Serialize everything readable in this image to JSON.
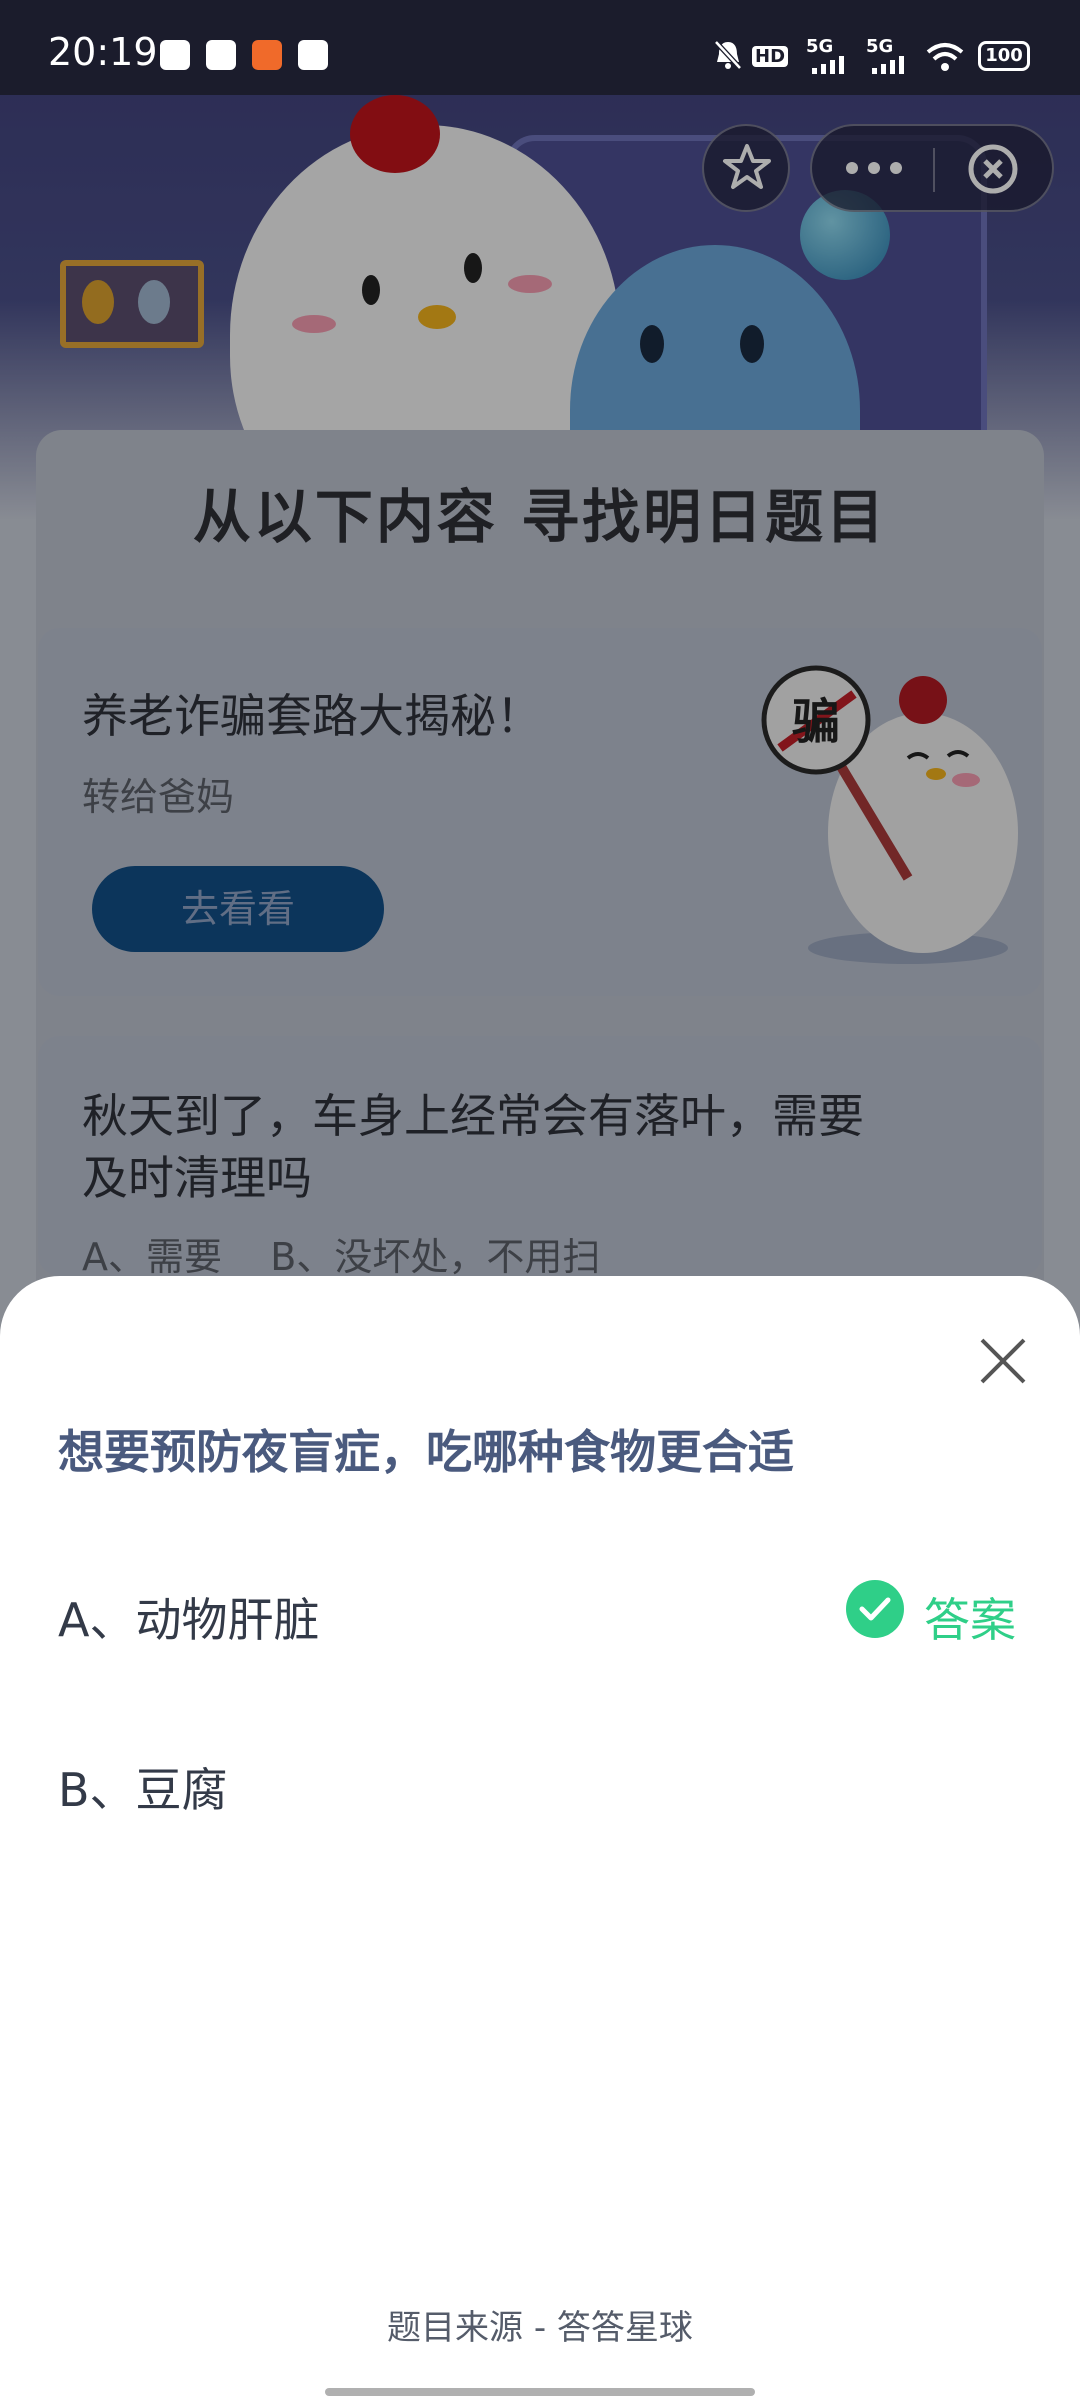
{
  "status_bar": {
    "time": "20:19",
    "network_hd": "HD",
    "network_5g_1": "5G",
    "network_5g_2": "5G",
    "battery": "100"
  },
  "capsule": {
    "star_icon": "star-outline-icon",
    "more_icon": "more-dots-icon",
    "close_icon": "close-circle-icon"
  },
  "background": {
    "finder_title": "从以下内容  寻找明日题目",
    "elder_card": {
      "title": "养老诈骗套路大揭秘！",
      "subtitle": "转给爸妈",
      "button": "去看看",
      "sign_text": "骗"
    },
    "leaf_card": {
      "title_line1": "秋天到了，车身上经常会有落叶，需要",
      "title_line2": "及时清理吗",
      "options": "A、需要    B、没坏处，不用扫"
    }
  },
  "sheet": {
    "question": "想要预防夜盲症，吃哪种食物更合适",
    "options": [
      {
        "label": "A、动物肝脏",
        "is_answer": true
      },
      {
        "label": "B、豆腐",
        "is_answer": false
      }
    ],
    "answer_label": "答案",
    "source": "题目来源 - 答答星球"
  },
  "colors": {
    "accent_green": "#2fcf88",
    "question_color": "#4a5a7e",
    "status_bar_bg": "#1b1c2c"
  }
}
